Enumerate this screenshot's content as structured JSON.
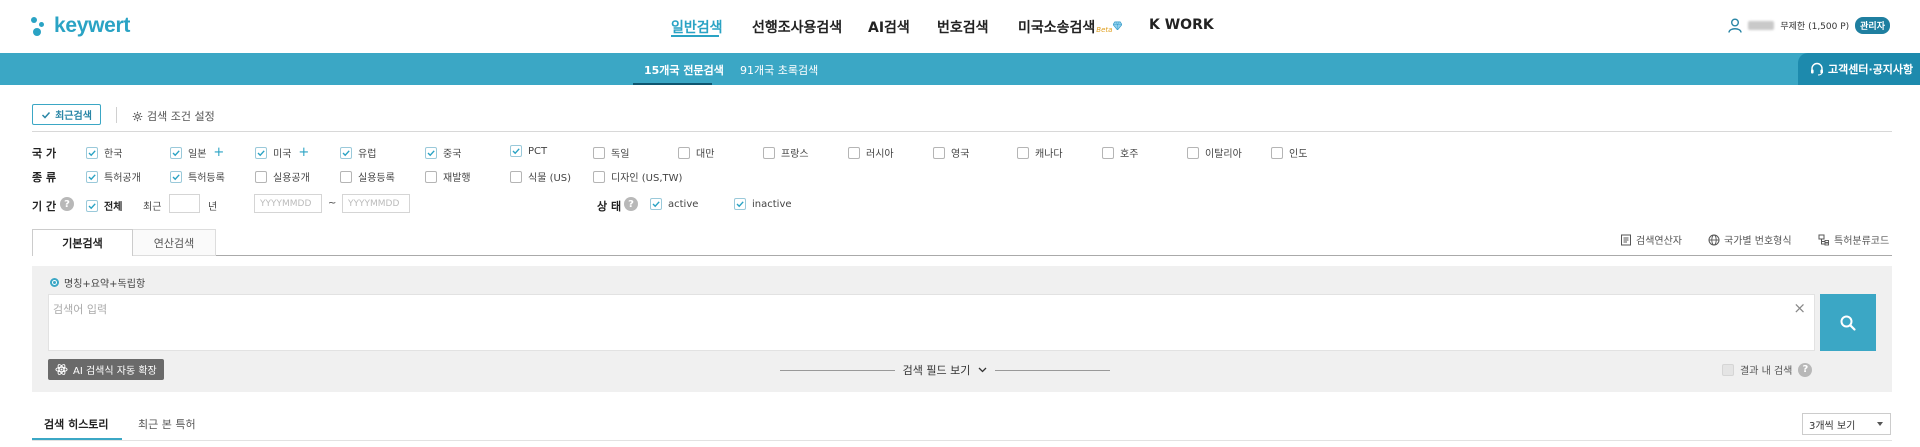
{
  "brand": {
    "name": "keywert",
    "color": "#2aa3c4"
  },
  "main_nav": [
    {
      "label": "일반검색",
      "active": true
    },
    {
      "label": "선행조사용검색",
      "active": false
    },
    {
      "label": "AI검색",
      "active": false
    },
    {
      "label": "번호검색",
      "active": false
    },
    {
      "label": "미국소송검색",
      "badge": "Beta",
      "active": false
    },
    {
      "label": "K WORK",
      "active": false
    }
  ],
  "user": {
    "plan": "무제한 (1,500 P)",
    "badge": "관리자",
    "icon": "user-icon"
  },
  "sub_nav": [
    {
      "label": "15개국 전문검색",
      "active": true
    },
    {
      "label": "91개국 초록검색",
      "active": false
    }
  ],
  "support": {
    "label": "고객센터·공지사항",
    "icon": "headset-icon"
  },
  "toolbar": {
    "recent_label": "최근검색",
    "conditions_label": "검색 조건 설정"
  },
  "filters": {
    "country": {
      "label": "국 가",
      "options": [
        {
          "label": "한국",
          "checked": true
        },
        {
          "label": "일본",
          "checked": true,
          "plus": "+"
        },
        {
          "label": "미국",
          "checked": true,
          "plus": "+"
        },
        {
          "label": "유럽",
          "checked": true
        },
        {
          "label": "중국",
          "checked": true
        },
        {
          "label": "PCT",
          "checked": true
        },
        {
          "label": "독일",
          "checked": false
        },
        {
          "label": "대만",
          "checked": false
        },
        {
          "label": "프랑스",
          "checked": false
        },
        {
          "label": "러시아",
          "checked": false
        },
        {
          "label": "영국",
          "checked": false
        },
        {
          "label": "캐나다",
          "checked": false
        },
        {
          "label": "호주",
          "checked": false
        },
        {
          "label": "이탈리아",
          "checked": false
        },
        {
          "label": "인도",
          "checked": false
        }
      ]
    },
    "kind": {
      "label": "종 류",
      "options": [
        {
          "label": "특허공개",
          "checked": true
        },
        {
          "label": "특허등록",
          "checked": true
        },
        {
          "label": "실용공개",
          "checked": false
        },
        {
          "label": "실용등록",
          "checked": false
        },
        {
          "label": "재발행",
          "checked": false
        },
        {
          "label": "식물 (US)",
          "checked": false
        },
        {
          "label": "디자인 (US,TW)",
          "checked": false
        }
      ]
    },
    "period": {
      "label": "기 간",
      "all_label": "전체",
      "all_checked": true,
      "recent_label": "최근",
      "year_label": "년",
      "date_from_placeholder": "YYYYMMDD",
      "tilde": "~",
      "date_to_placeholder": "YYYYMMDD"
    },
    "status": {
      "label": "상 태",
      "options": [
        {
          "label": "active",
          "checked": true
        },
        {
          "label": "inactive",
          "checked": true
        }
      ]
    }
  },
  "search_tabs": [
    {
      "label": "기본검색",
      "active": true
    },
    {
      "label": "연산검색",
      "active": false
    }
  ],
  "tools": [
    {
      "label": "검색연산자",
      "icon": "document-icon"
    },
    {
      "label": "국가별 번호형식",
      "icon": "globe-icon"
    },
    {
      "label": "특허분류코드",
      "icon": "classification-icon"
    }
  ],
  "search": {
    "scope_label": "명칭+요약+독립항",
    "placeholder": "검색어 입력",
    "ai_expand_label": "AI 검색식 자동 확장",
    "field_toggle_label": "검색 필드 보기",
    "in_results_label": "결과 내 검색"
  },
  "history_tabs": [
    {
      "label": "검색 히스토리",
      "active": true
    },
    {
      "label": "최근 본 특허",
      "active": false
    }
  ],
  "per_page": {
    "value": "3개씩 보기"
  },
  "colors": {
    "accent": "#3ba7c5",
    "accent_dark": "#1d8aad",
    "admin": "#1f7fa0"
  }
}
